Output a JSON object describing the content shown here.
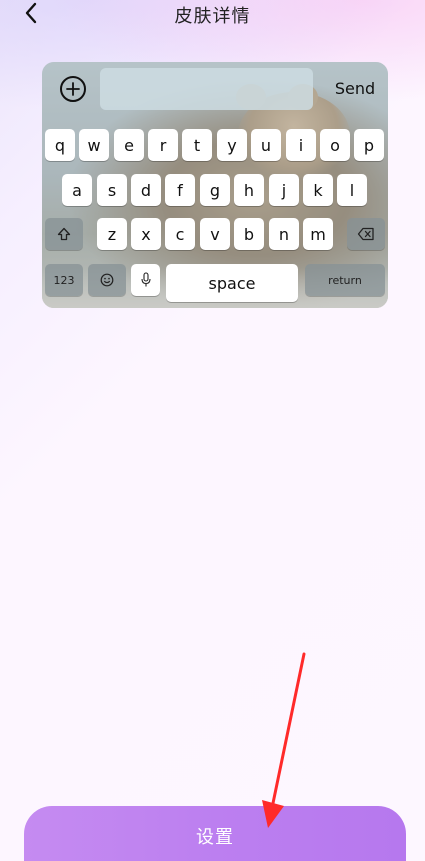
{
  "header": {
    "title": "皮肤详情",
    "back_icon": "chevron-left-icon"
  },
  "keyboard_preview": {
    "send_label": "Send",
    "plus_icon": "plus-circle-icon",
    "rows": [
      [
        "q",
        "w",
        "e",
        "r",
        "t",
        "y",
        "u",
        "i",
        "o",
        "p"
      ],
      [
        "a",
        "s",
        "d",
        "f",
        "g",
        "h",
        "j",
        "k",
        "l"
      ],
      [
        "z",
        "x",
        "c",
        "v",
        "b",
        "n",
        "m"
      ]
    ],
    "shift_icon": "shift-icon",
    "backspace_icon": "backspace-icon",
    "numbers_label": "123",
    "emoji_icon": "emoji-icon",
    "mic_icon": "microphone-icon",
    "space_label": "space",
    "return_label": "return"
  },
  "action": {
    "button_label": "设置"
  },
  "annotation": {
    "color": "#ff2a2a",
    "icon": "red-arrow-annotation"
  }
}
